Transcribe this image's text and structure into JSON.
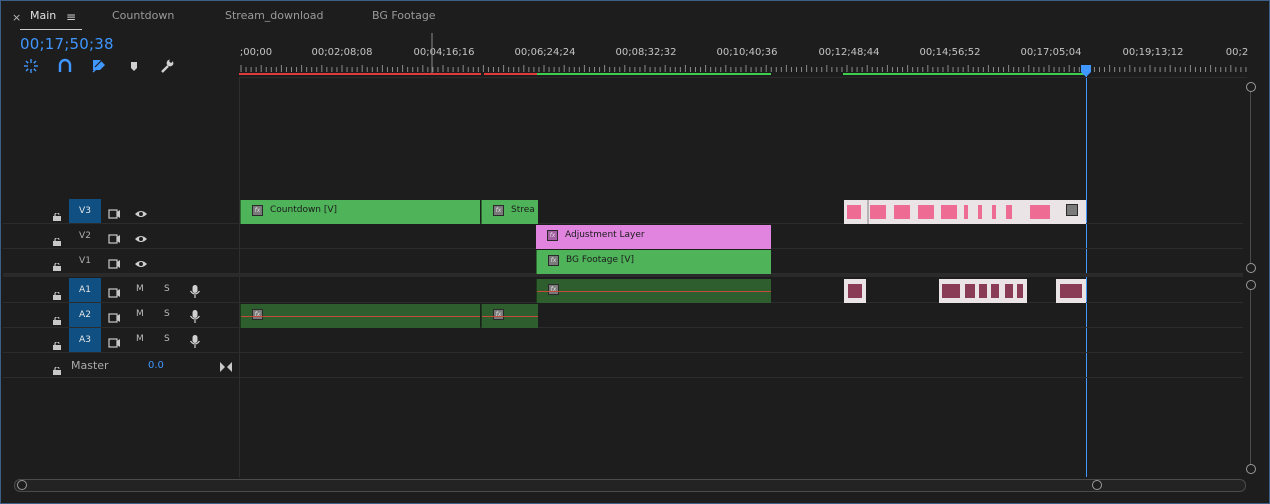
{
  "tabs": {
    "close_glyph": "×",
    "menu_glyph": "≡",
    "items": [
      "Main",
      "Countdown",
      "Stream_download",
      "BG Footage"
    ]
  },
  "timecode": "00;17;50;38",
  "toolbar": {
    "icons": [
      "snap-icon",
      "linked-selection-icon",
      "add-marker-icon",
      "marker-icon",
      "wrench-icon"
    ]
  },
  "ruler": {
    "labels": [
      ";00;00",
      "00;02;08;08",
      "00;04;16;16",
      "00;06;24;24",
      "00;08;32;32",
      "00;10;40;36",
      "00;12;48;44",
      "00;14;56;52",
      "00;17;05;04",
      "00;19;13;12",
      "00;2"
    ]
  },
  "tracks": {
    "video": [
      {
        "label": "V3",
        "targeted": true
      },
      {
        "label": "V2",
        "targeted": false
      },
      {
        "label": "V1",
        "targeted": false
      }
    ],
    "audio": [
      {
        "label": "A1",
        "targeted": true,
        "mute": "M",
        "solo": "S"
      },
      {
        "label": "A2",
        "targeted": true,
        "mute": "M",
        "solo": "S"
      },
      {
        "label": "A3",
        "targeted": true,
        "mute": "M",
        "solo": "S"
      }
    ],
    "master": {
      "label": "Master",
      "value": "0.0"
    }
  },
  "clips": {
    "countdown": "Countdown [V]",
    "stream": "Strea",
    "adjustment": "Adjustment Layer",
    "bg_footage": "BG Footage [V]",
    "fx_glyph": "fx"
  },
  "colors": {
    "accent": "#3f97ff",
    "video_clip": "#4fb35a",
    "adjustment_clip": "#e184e0",
    "audio_clip": "#2f5e2e",
    "pink_clip": "#ee6c94",
    "render_red": "#e03a3a",
    "render_green": "#3ecf4e"
  }
}
